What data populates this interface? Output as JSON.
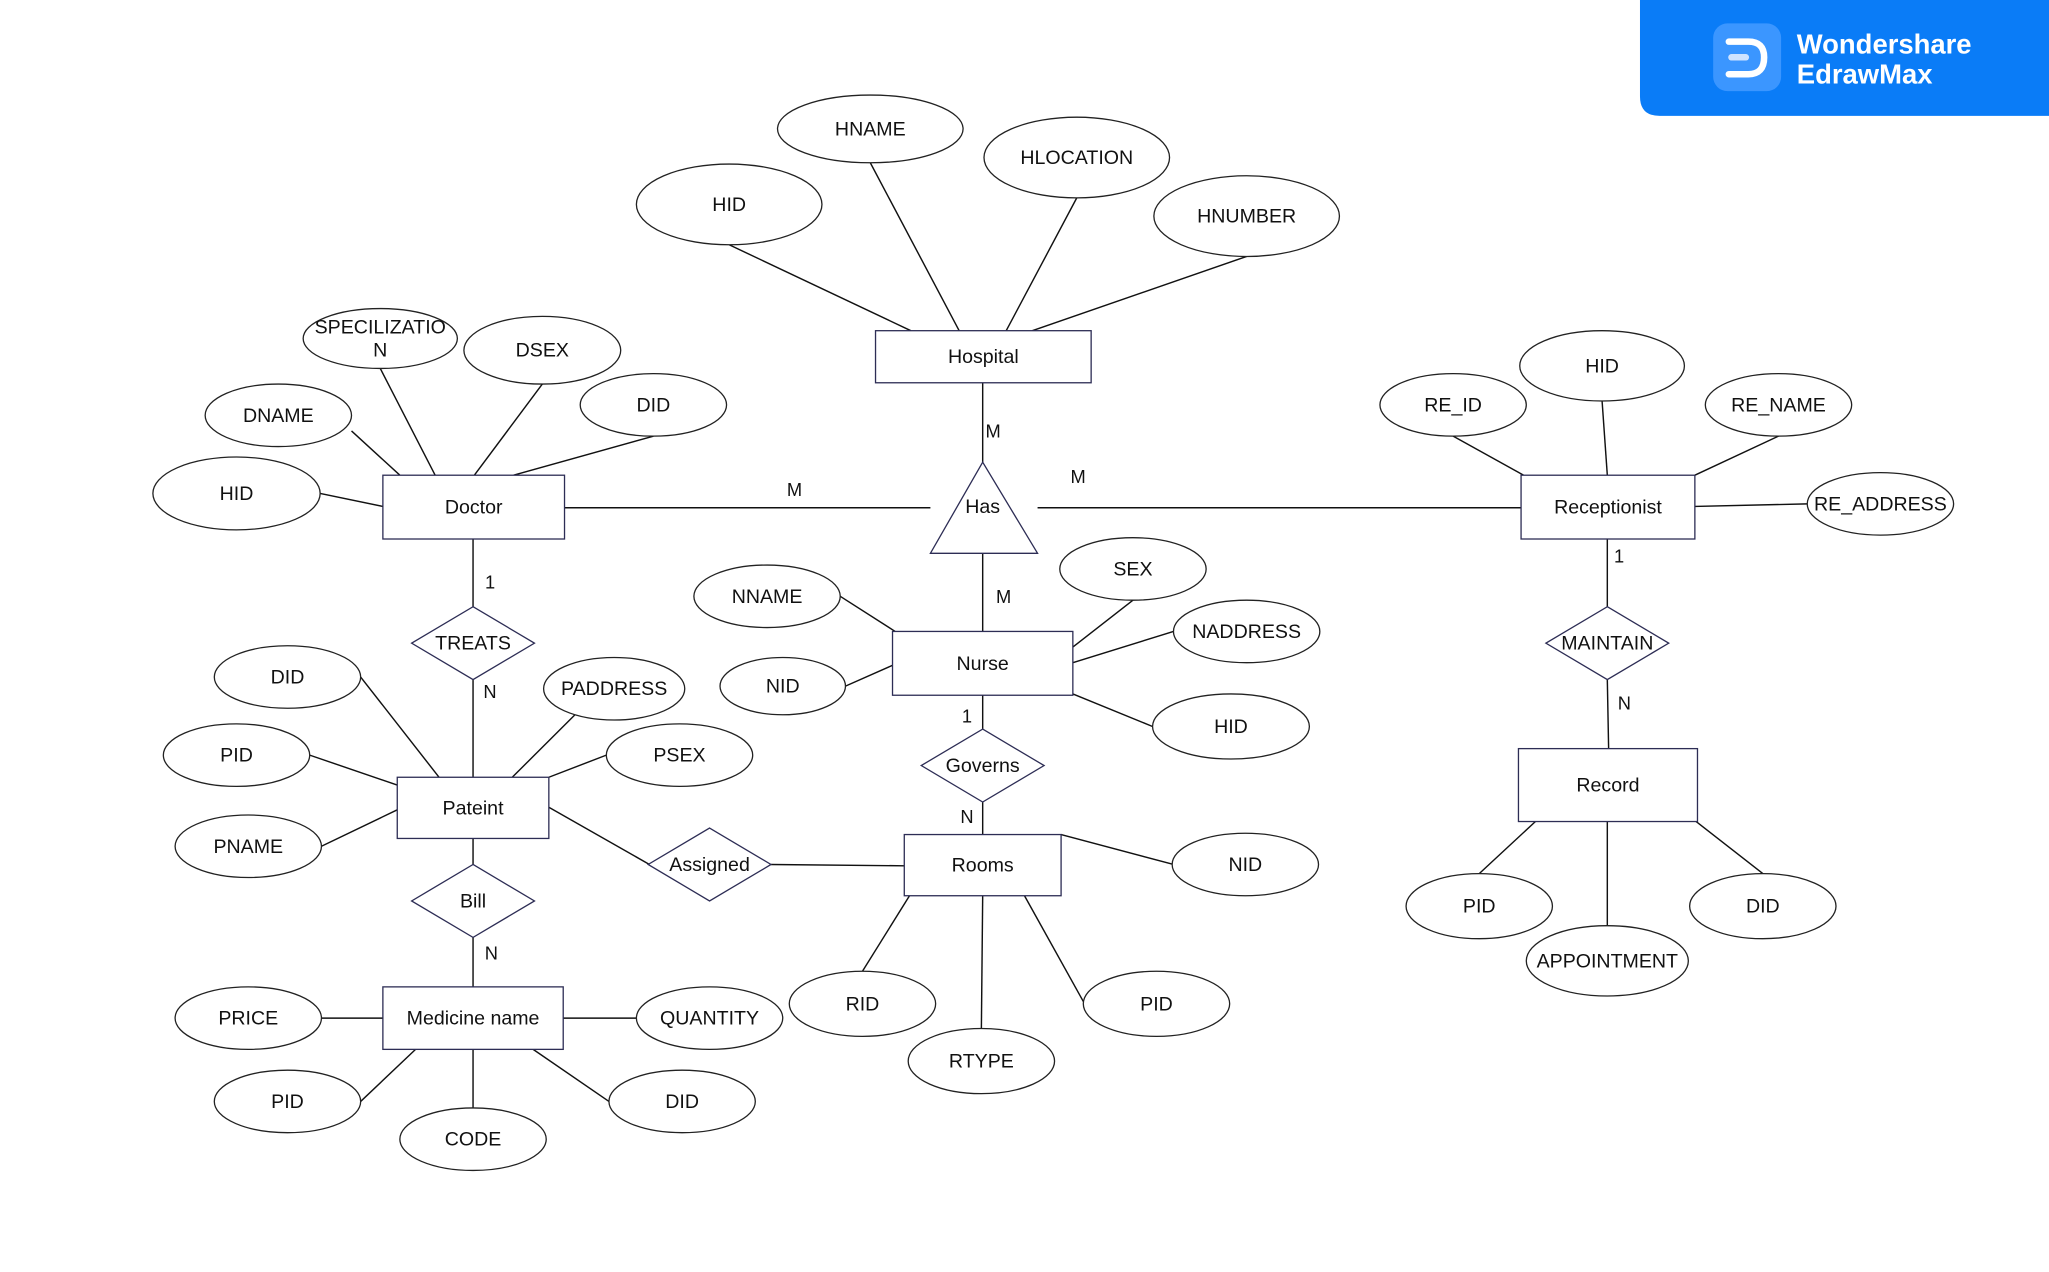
{
  "logo": {
    "line1": "Wondershare",
    "line2": "EdrawMax",
    "brand_color": "#0a7cf7",
    "icon": "edrawmax-logo-icon"
  },
  "entities": {
    "hospital": "Hospital",
    "doctor": "Doctor",
    "receptionist": "Receptionist",
    "nurse": "Nurse",
    "pateint": "Pateint",
    "rooms": "Rooms",
    "record": "Record",
    "medicine": "Medicine name"
  },
  "relationships": {
    "has": "Has",
    "treats": "TREATS",
    "maintain": "MAINTAIN",
    "governs": "Governs",
    "assigned": "Assigned",
    "bill": "Bill"
  },
  "attributes": {
    "hospital_hname": "HNAME",
    "hospital_hid": "HID",
    "hospital_hlocation": "HLOCATION",
    "hospital_hnumber": "HNUMBER",
    "doctor_spec_1": "SPECILIZATIO",
    "doctor_spec_2": "N",
    "doctor_dsex": "DSEX",
    "doctor_did": "DID",
    "doctor_dname": "DNAME",
    "doctor_hid": "HID",
    "rec_re_id": "RE_ID",
    "rec_hid": "HID",
    "rec_re_name": "RE_NAME",
    "rec_re_address": "RE_ADDRESS",
    "nurse_nname": "NNAME",
    "nurse_nid": "NID",
    "nurse_sex": "SEX",
    "nurse_naddress": "NADDRESS",
    "nurse_hid": "HID",
    "pat_did": "DID",
    "pat_paddress": "PADDRESS",
    "pat_pid": "PID",
    "pat_psex": "PSEX",
    "pat_pname": "PNAME",
    "rooms_nid": "NID",
    "rooms_rid": "RID",
    "rooms_rtype": "RTYPE",
    "rooms_pid": "PID",
    "record_pid": "PID",
    "record_appointment": "APPOINTMENT",
    "record_did": "DID",
    "med_price": "PRICE",
    "med_quantity": "QUANTITY",
    "med_pid": "PID",
    "med_code": "CODE",
    "med_did": "DID"
  },
  "cardinalities": [
    "M",
    "M",
    "M",
    "M",
    "1",
    "N",
    "1",
    "N",
    "1",
    "N",
    "N"
  ]
}
